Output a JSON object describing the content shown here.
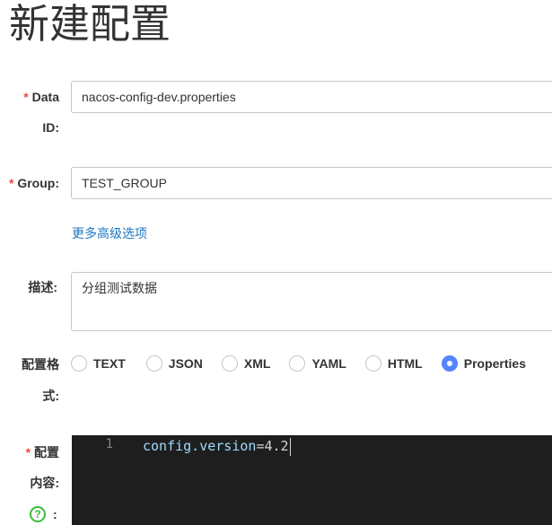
{
  "page": {
    "title": "新建配置"
  },
  "form": {
    "required_mark": "*",
    "data_id": {
      "label_line1": "Data",
      "label_line2": "ID:",
      "value": "nacos-config-dev.properties"
    },
    "group": {
      "label": "Group:",
      "value": "TEST_GROUP"
    },
    "advanced_link": "更多高级选项",
    "description": {
      "label": "描述:",
      "value": "分组测试数据"
    },
    "format": {
      "label_line1": "配置格",
      "label_line2": "式:",
      "options": [
        "TEXT",
        "JSON",
        "XML",
        "YAML",
        "HTML",
        "Properties"
      ],
      "selected": "Properties"
    },
    "content": {
      "label_line1": "配置",
      "label_line2": "内容:",
      "help_icon": "question-circle-icon",
      "help_glyph": "?",
      "help_suffix": ":",
      "line_number": "1",
      "code_key": "config.version",
      "code_eq": "=",
      "code_value": "4.2"
    }
  },
  "colors": {
    "required": "#e84c3d",
    "link": "#2077c2",
    "radio_checked": "#5584ff",
    "editor_bg": "#1e1e1e",
    "help_icon": "#3bbd3b"
  }
}
